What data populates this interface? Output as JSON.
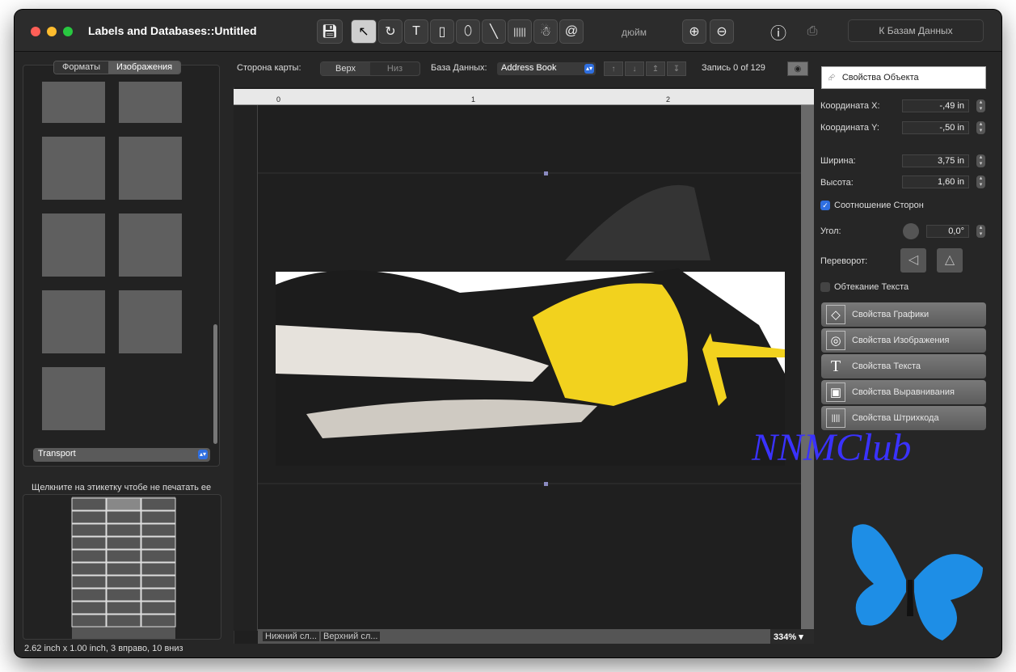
{
  "window": {
    "title": "Labels and  Databases::Untitled"
  },
  "toolbar": {
    "unit": "дюйм",
    "back_button": "К Базам Данных",
    "tools": [
      "save-icon",
      "arrow-icon",
      "rotate-icon",
      "text-icon",
      "rectangle-icon",
      "ellipse-icon",
      "line-icon",
      "barcode-icon",
      "image-icon",
      "email-icon"
    ]
  },
  "left": {
    "tabs": [
      "Форматы",
      "Изображения"
    ],
    "active_tab": "Изображения",
    "category": "Transport",
    "hint": "Щелкните на этикетку чтобе не печатать ее",
    "status": "2.62 inch x 1.00 inch, 3 вправо, 10 вниз"
  },
  "topbar": {
    "side_label": "Сторона карты:",
    "side_options": [
      "Верх",
      "Низ"
    ],
    "db_label": "База Данных:",
    "db_value": "Address Book",
    "record": "Запись 0 of 129"
  },
  "canvas": {
    "ruler_labels": [
      "0",
      "1",
      "2"
    ],
    "layer_bottom": "Нижний сл...",
    "layer_top": "Верхний сл...",
    "zoom": "334%",
    "watermark": "NNMClub"
  },
  "right": {
    "object_props": "Свойства Объекта",
    "coord_x_label": "Координата X:",
    "coord_x": "-,49 in",
    "coord_y_label": "Координата Y:",
    "coord_y": "-,50 in",
    "width_label": "Ширина:",
    "width": "3,75 in",
    "height_label": "Высота:",
    "height": "1,60 in",
    "aspect_label": "Соотношение Сторон",
    "angle_label": "Угол:",
    "angle": "0,0°",
    "flip_label": "Переворот:",
    "wrap_label": "Обтекание Текста",
    "buttons": [
      "Свойства Графики",
      "Свойства Изображения",
      "Свойства Текста",
      "Свойства Выравнивания",
      "Свойства Штрихкода"
    ]
  }
}
